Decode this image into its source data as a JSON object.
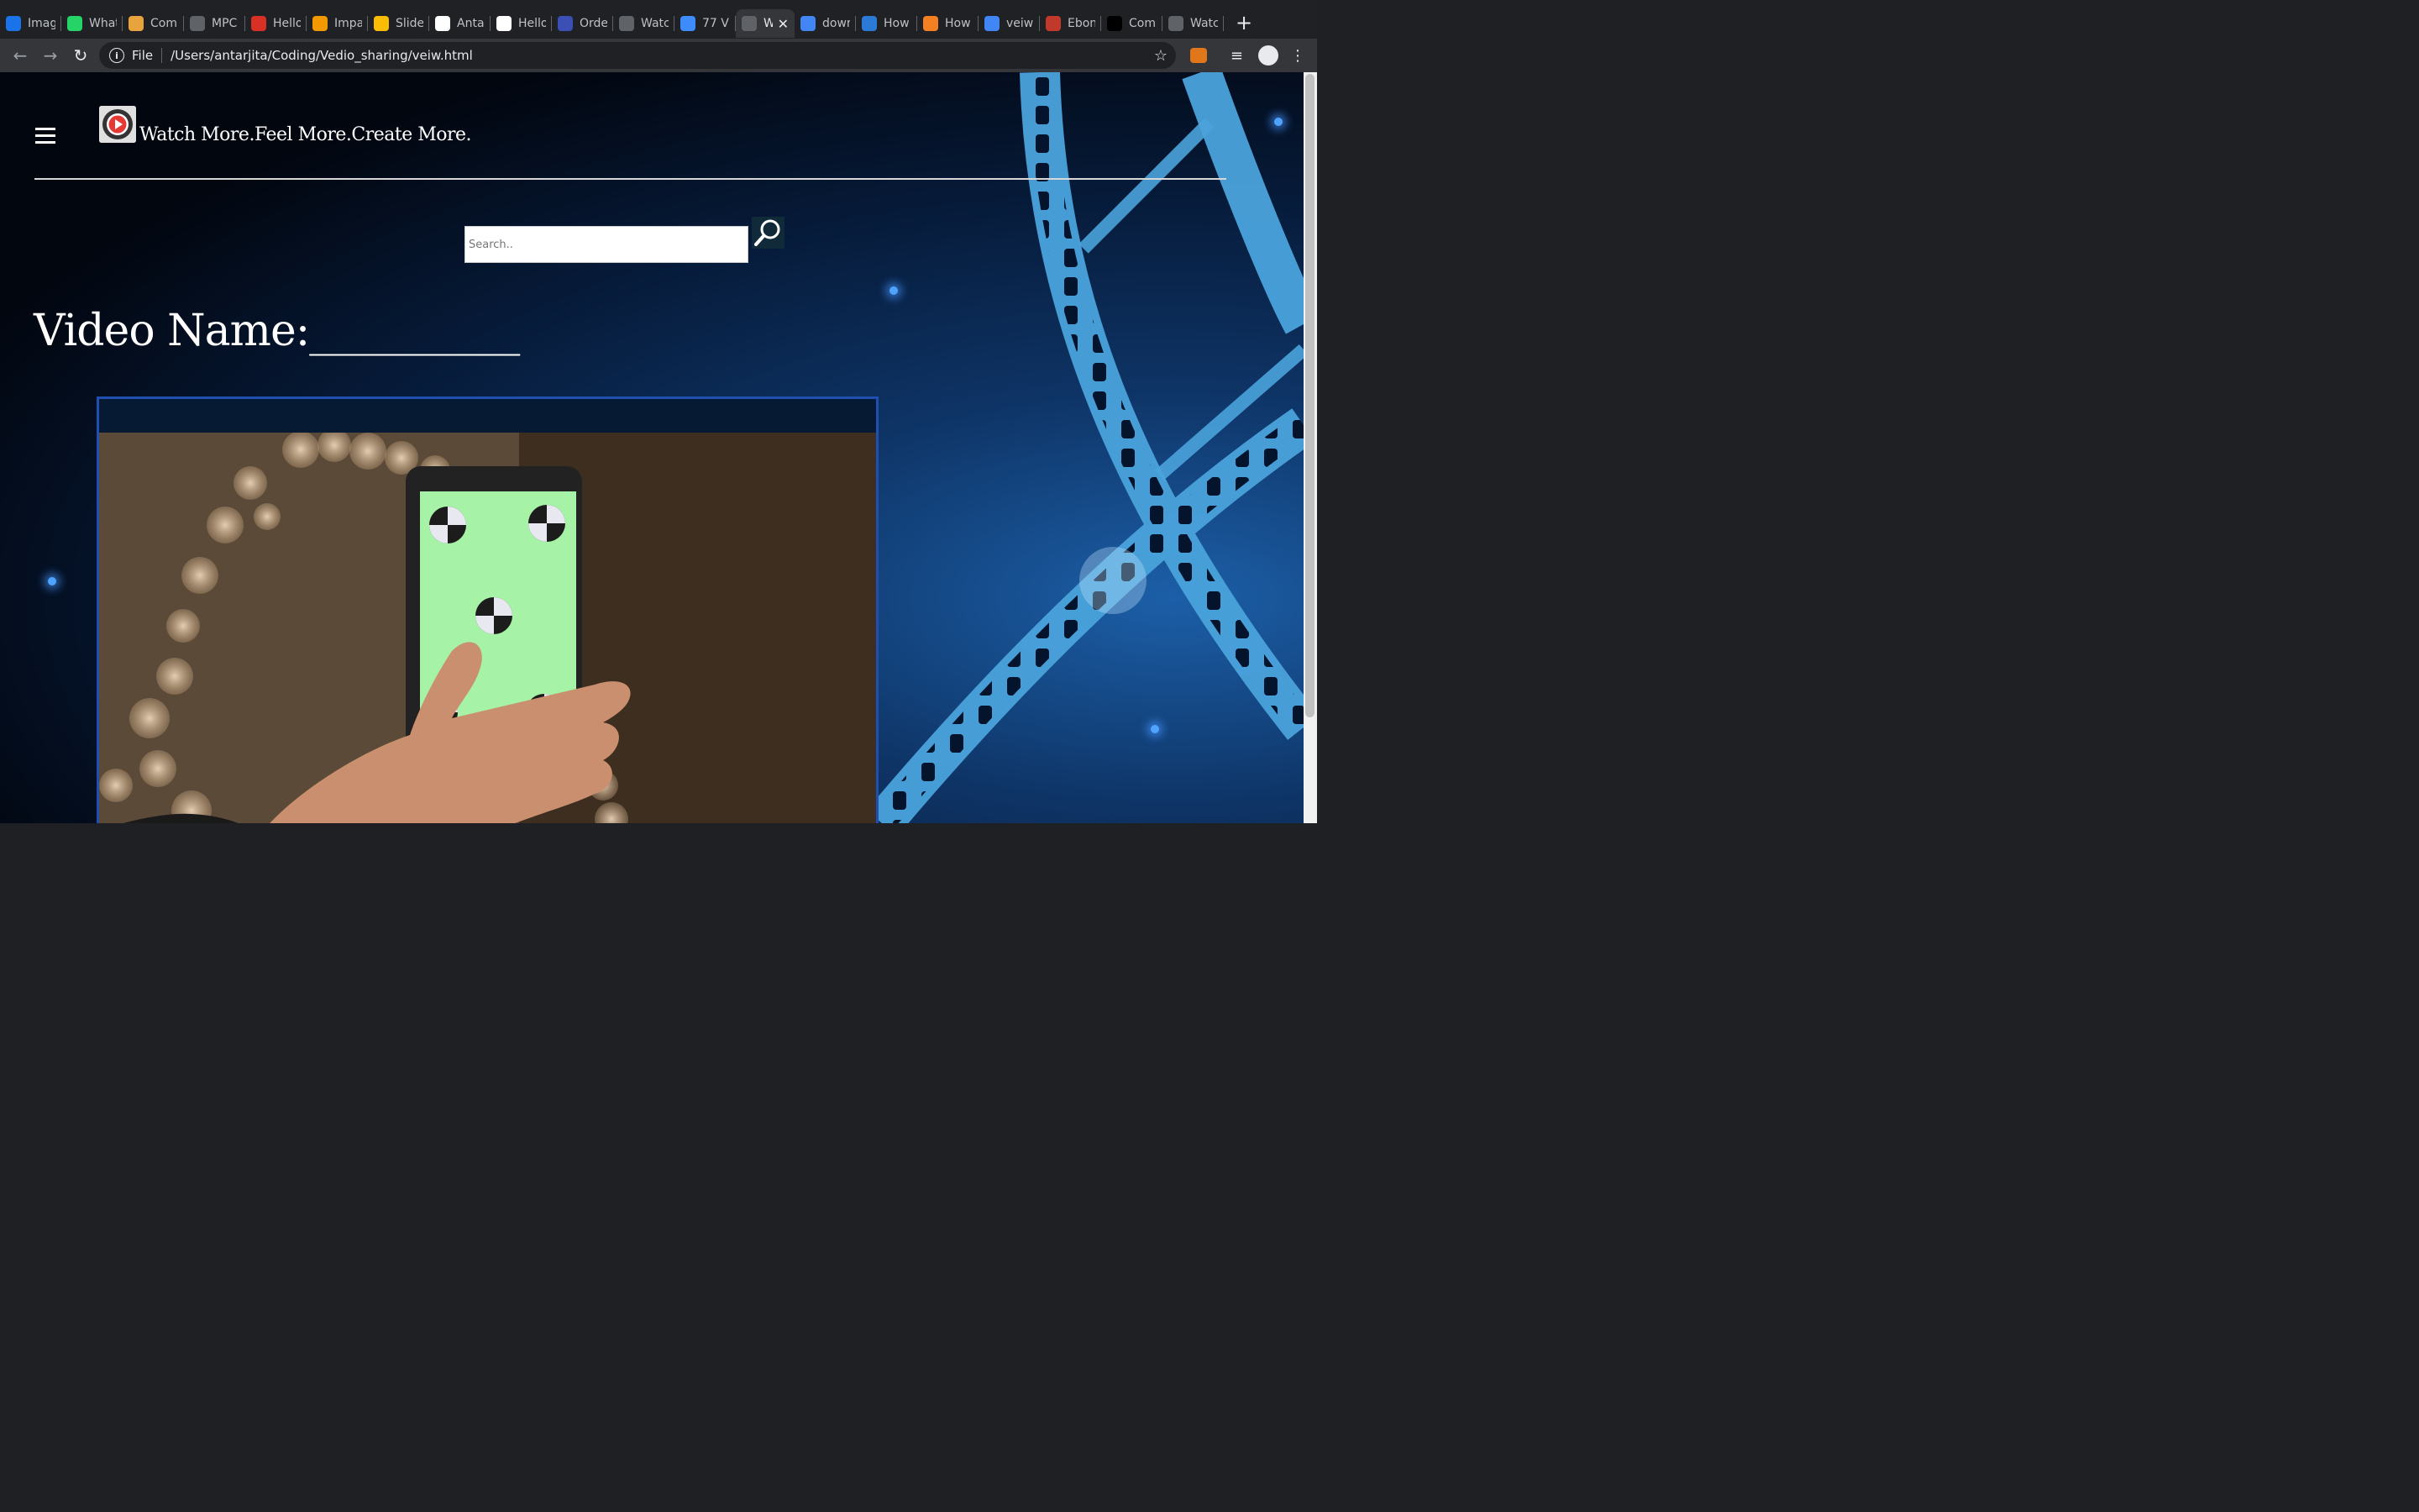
{
  "browser": {
    "tabs": [
      {
        "title": "Imag",
        "icon": "is-icon",
        "color": "#1a73e8"
      },
      {
        "title": "What",
        "icon": "whatsapp-icon",
        "color": "#25d366"
      },
      {
        "title": "Com",
        "icon": "book-icon",
        "color": "#e8a33d"
      },
      {
        "title": "MPC",
        "icon": "globe-icon",
        "color": "#5f6368"
      },
      {
        "title": "Hello",
        "icon": "gmail-icon",
        "color": "#d93025"
      },
      {
        "title": "Impa",
        "icon": "spark-icon",
        "color": "#f29900"
      },
      {
        "title": "Slide",
        "icon": "drive-icon",
        "color": "#fbbc04"
      },
      {
        "title": "Anta",
        "icon": "github-icon",
        "color": "#ffffff"
      },
      {
        "title": "Hello",
        "icon": "github-icon",
        "color": "#ffffff"
      },
      {
        "title": "Orde",
        "icon": "p-icon",
        "color": "#3c4fb5"
      },
      {
        "title": "Watc",
        "icon": "globe-icon",
        "color": "#5f6368"
      },
      {
        "title": "77 V",
        "icon": "n-icon",
        "color": "#3d8bfd"
      },
      {
        "title": "W",
        "icon": "globe-icon",
        "color": "#5f6368",
        "active": true
      },
      {
        "title": "dowr",
        "icon": "google-icon",
        "color": "#4285f4"
      },
      {
        "title": "How",
        "icon": "snowflake-icon",
        "color": "#2b7bd6"
      },
      {
        "title": "How",
        "icon": "stack-icon",
        "color": "#f48024"
      },
      {
        "title": "veiw",
        "icon": "google-icon",
        "color": "#4285f4"
      },
      {
        "title": "Ebon",
        "icon": "m-icon",
        "color": "#c0392b"
      },
      {
        "title": "Com",
        "icon": "ps-icon",
        "color": "#000000"
      },
      {
        "title": "Watc",
        "icon": "globe-icon",
        "color": "#5f6368"
      }
    ],
    "close_glyph": "✕",
    "new_tab_glyph": "+",
    "url_protocol": "File",
    "url": "/Users/antarjita/Coding/Vedio_sharing/veiw.html"
  },
  "page": {
    "brand": "Watch More.Feel More.Create More.",
    "search_placeholder": "Search..",
    "video_title": "Video Name:__________"
  },
  "colors": {
    "accent_border": "#1f4fb0",
    "film_strip": "#4aa3dc"
  }
}
